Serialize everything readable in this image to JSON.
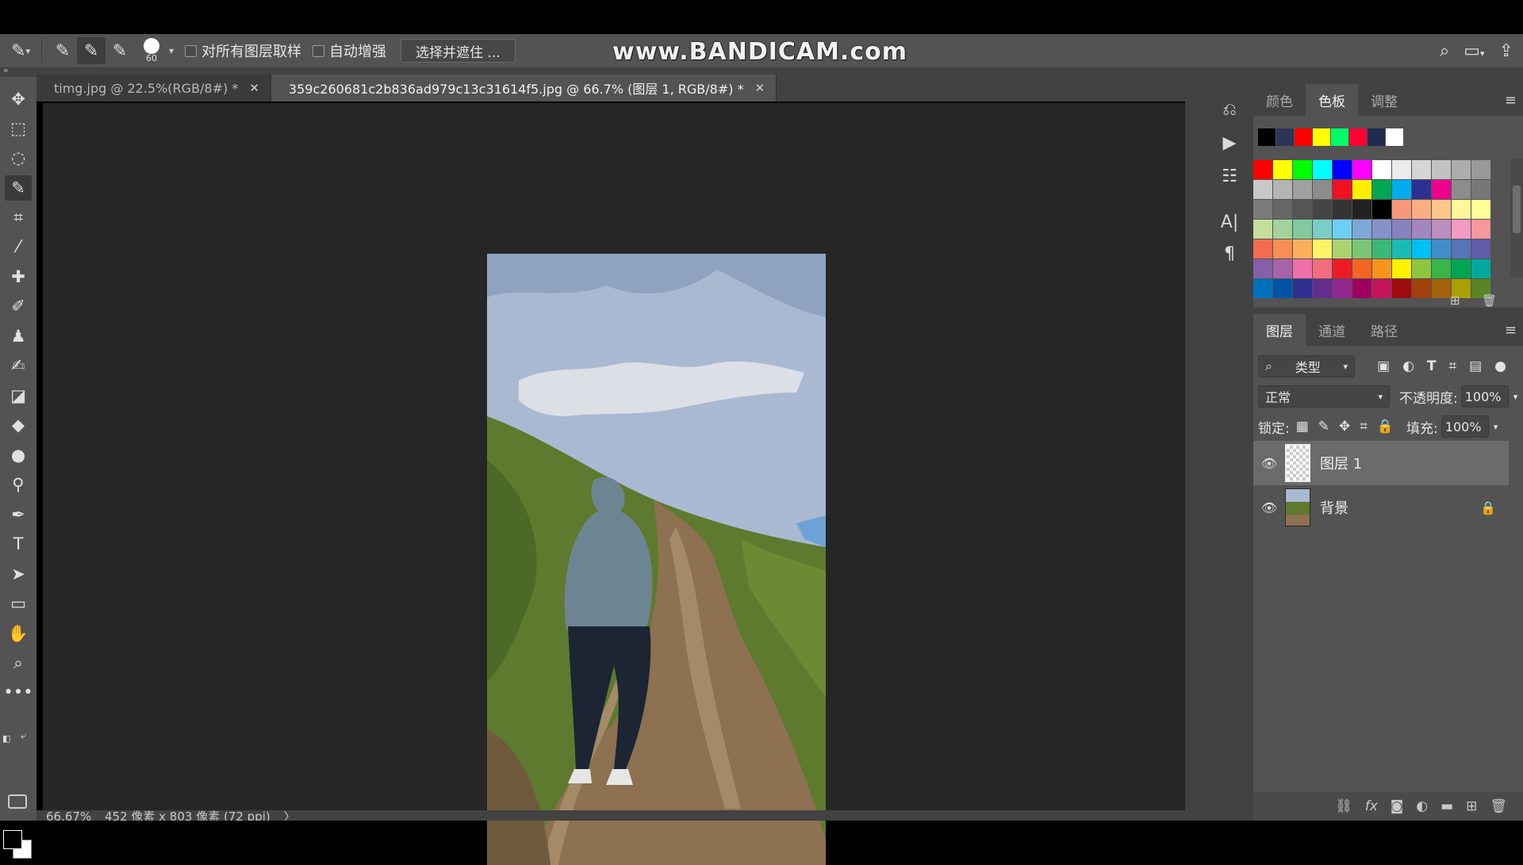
{
  "watermark": "www.BANDICAM.com",
  "options_bar": {
    "brush_size": "60",
    "sample_all_layers_label": "对所有图层取样",
    "auto_enhance_label": "自动增强",
    "select_and_mask_label": "选择并遮住 ..."
  },
  "document_tabs": [
    {
      "label": "timg.jpg @ 22.5%(RGB/8#) *",
      "active": false
    },
    {
      "label": "359c260681c2b836ad979c13c31614f5.jpg @ 66.7% (图层 1, RGB/8#) *",
      "active": true
    }
  ],
  "status_bar": {
    "zoom": "66.67%",
    "doc_info": "452 像素 x 803 像素 (72 ppi)"
  },
  "swatches_panel": {
    "tabs": [
      "颜色",
      "色板",
      "调整"
    ],
    "active_tab": "色板",
    "recent": [
      "#000000",
      "#2b3557",
      "#ff0000",
      "#ffff00",
      "#00ff66",
      "#ff0033",
      "#1f2a50",
      "#ffffff"
    ],
    "grid": [
      "#ff0000",
      "#ffff00",
      "#00ff00",
      "#00ffff",
      "#0000ff",
      "#ff00ff",
      "#ffffff",
      "#ebebeb",
      "#d6d6d6",
      "#c2c2c2",
      "#adadad",
      "#999999",
      "#c8c8c8",
      "#b4b4b4",
      "#a0a0a0",
      "#8c8c8c",
      "#ee1122",
      "#ffee00",
      "#00a651",
      "#00aeef",
      "#2e3192",
      "#ec008c",
      "#8c8c8c",
      "#777777",
      "#7a7a7a",
      "#666666",
      "#555555",
      "#444444",
      "#333333",
      "#222222",
      "#000000",
      "#f7977a",
      "#f9ad81",
      "#fdc68a",
      "#fff79a",
      "#ffff99",
      "#c4df9b",
      "#a3d39c",
      "#82ca9d",
      "#7bcdc8",
      "#6ecff6",
      "#7ea7d8",
      "#8493ca",
      "#8882be",
      "#a187be",
      "#bc8dbf",
      "#f49ac2",
      "#f6989d",
      "#f26c4f",
      "#f68e55",
      "#fbaf5c",
      "#fff467",
      "#acd372",
      "#7cc576",
      "#3bb878",
      "#1abbb4",
      "#00bff3",
      "#438cca",
      "#5574b9",
      "#605ca8",
      "#855fa8",
      "#a763a8",
      "#f06ea9",
      "#f26d7d",
      "#ed1c24",
      "#f26522",
      "#f7941d",
      "#fff200",
      "#8dc73f",
      "#39b54a",
      "#00a651",
      "#00a99d",
      "#0072bc",
      "#0054a6",
      "#2e3192",
      "#662d91",
      "#92278f",
      "#9e005d",
      "#c4145a",
      "#9e0b0f",
      "#a0410d",
      "#a36209",
      "#aba000",
      "#598527"
    ]
  },
  "layers_panel": {
    "tabs": [
      "图层",
      "通道",
      "路径"
    ],
    "active_tab": "图层",
    "filter_kind": "类型",
    "blend_mode": "正常",
    "opacity_label": "不透明度:",
    "opacity_value": "100%",
    "lock_label": "锁定:",
    "fill_label": "填充:",
    "fill_value": "100%",
    "layers": [
      {
        "name": "图层 1",
        "selected": true,
        "locked": false
      },
      {
        "name": "背景",
        "selected": false,
        "locked": true
      }
    ]
  },
  "icons": {
    "toolbar": [
      "move-icon",
      "marquee-icon",
      "lasso-icon",
      "quick-selection-icon",
      "crop-icon",
      "eyedropper-icon",
      "healing-brush-icon",
      "brush-icon",
      "clone-stamp-icon",
      "history-brush-icon",
      "eraser-icon",
      "paint-bucket-icon",
      "blur-icon",
      "dodge-icon",
      "pen-icon",
      "type-icon",
      "path-selection-icon",
      "rectangle-icon",
      "hand-icon",
      "zoom-icon",
      "more-tools-icon"
    ]
  }
}
